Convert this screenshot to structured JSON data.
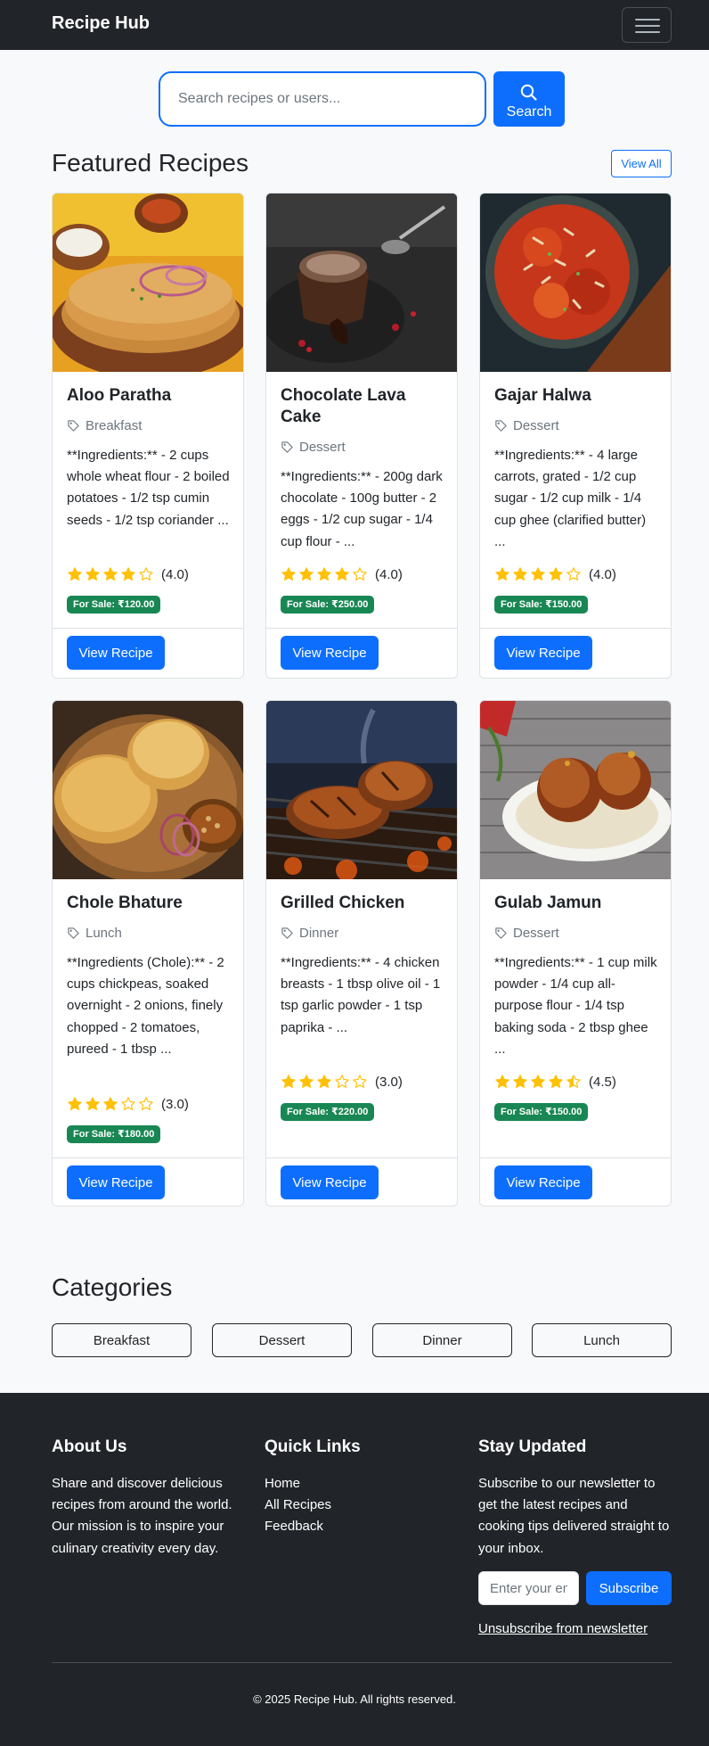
{
  "navbar": {
    "brand": "Recipe Hub"
  },
  "search": {
    "placeholder": "Search recipes or users...",
    "button_label": "Search"
  },
  "featured": {
    "title": "Featured Recipes",
    "view_all_label": "View All",
    "recipes": [
      {
        "title": "Aloo Paratha",
        "category": "Breakfast",
        "description": "**Ingredients:** - 2 cups whole wheat flour - 2 boiled potatoes - 1/2 tsp cumin seeds - 1/2 tsp coriander ...",
        "rating": 4.0,
        "rating_text": "(4.0)",
        "sale": "For Sale: ₹120.00",
        "button": "View Recipe"
      },
      {
        "title": "Chocolate Lava Cake",
        "category": "Dessert",
        "description": "**Ingredients:** - 200g dark chocolate - 100g butter - 2 eggs - 1/2 cup sugar - 1/4 cup flour - ...",
        "rating": 4.0,
        "rating_text": "(4.0)",
        "sale": "For Sale: ₹250.00",
        "button": "View Recipe"
      },
      {
        "title": "Gajar Halwa",
        "category": "Dessert",
        "description": "**Ingredients:** - 4 large carrots, grated - 1/2 cup sugar - 1/2 cup milk - 1/4 cup ghee (clarified butter) ...",
        "rating": 4.0,
        "rating_text": "(4.0)",
        "sale": "For Sale: ₹150.00",
        "button": "View Recipe"
      },
      {
        "title": "Chole Bhature",
        "category": "Lunch",
        "description": "**Ingredients (Chole):** - 2 cups chickpeas, soaked overnight - 2 onions, finely chopped - 2 tomatoes, pureed - 1 tbsp ...",
        "rating": 3.0,
        "rating_text": "(3.0)",
        "sale": "For Sale: ₹180.00",
        "button": "View Recipe"
      },
      {
        "title": "Grilled Chicken",
        "category": "Dinner",
        "description": "**Ingredients:** - 4 chicken breasts - 1 tbsp olive oil - 1 tsp garlic powder - 1 tsp paprika - ...",
        "rating": 3.0,
        "rating_text": "(3.0)",
        "sale": "For Sale: ₹220.00",
        "button": "View Recipe"
      },
      {
        "title": "Gulab Jamun",
        "category": "Dessert",
        "description": "**Ingredients:** - 1 cup milk powder - 1/4 cup all-purpose flour - 1/4 tsp baking soda - 2 tbsp ghee ...",
        "rating": 4.5,
        "rating_text": "(4.5)",
        "sale": "For Sale: ₹150.00",
        "button": "View Recipe"
      }
    ]
  },
  "categories": {
    "title": "Categories",
    "items": [
      "Breakfast",
      "Dessert",
      "Dinner",
      "Lunch"
    ]
  },
  "footer": {
    "about_title": "About Us",
    "about_text": "Share and discover delicious recipes from around the world. Our mission is to inspire your culinary creativity every day.",
    "links_title": "Quick Links",
    "links": [
      "Home",
      "All Recipes",
      "Feedback"
    ],
    "newsletter_title": "Stay Updated",
    "newsletter_text": "Subscribe to our newsletter to get the latest recipes and cooking tips delivered straight to your inbox.",
    "email_placeholder": "Enter your email",
    "subscribe_label": "Subscribe",
    "unsubscribe_label": "Unsubscribe from newsletter",
    "copyright": "© 2025 Recipe Hub. All rights reserved."
  },
  "colors": {
    "primary": "#0d6efd",
    "dark": "#212529",
    "success": "#198754",
    "star": "#ffc107"
  }
}
